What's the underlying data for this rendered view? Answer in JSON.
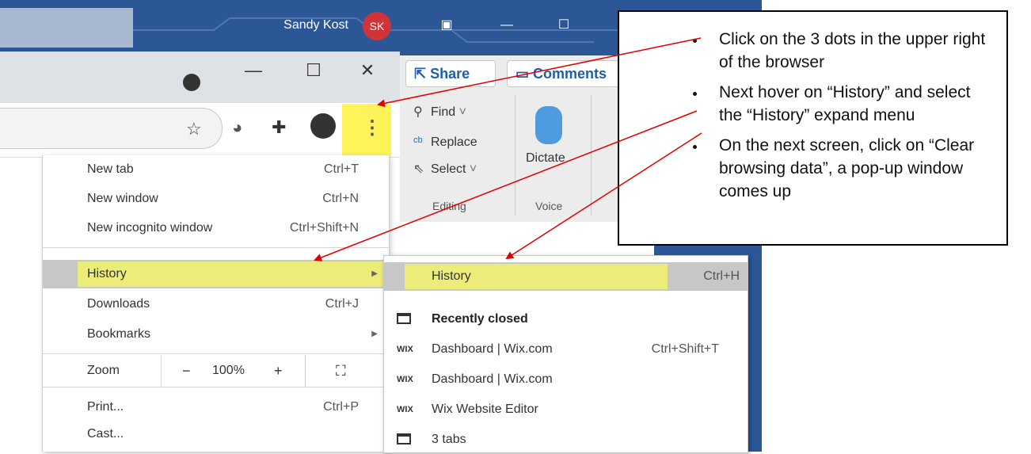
{
  "office": {
    "user_name": "Sandy Kost",
    "user_initials": "SK",
    "share_label": "Share",
    "comments_label": "Comments",
    "find_label": "Find",
    "replace_label": "Replace",
    "select_label": "Select",
    "dictate_label": "Dictate",
    "editing_group": "Editing",
    "voice_group": "Voice"
  },
  "chrome_menu": {
    "new_tab": {
      "label": "New tab",
      "shortcut": "Ctrl+T"
    },
    "new_window": {
      "label": "New window",
      "shortcut": "Ctrl+N"
    },
    "new_incognito": {
      "label": "New incognito window",
      "shortcut": "Ctrl+Shift+N"
    },
    "history": {
      "label": "History"
    },
    "downloads": {
      "label": "Downloads",
      "shortcut": "Ctrl+J"
    },
    "bookmarks": {
      "label": "Bookmarks"
    },
    "zoom": {
      "label": "Zoom",
      "minus": "−",
      "value": "100%",
      "plus": "+"
    },
    "print": {
      "label": "Print...",
      "shortcut": "Ctrl+P"
    },
    "cast": {
      "label": "Cast..."
    }
  },
  "history_submenu": {
    "history": {
      "label": "History",
      "shortcut": "Ctrl+H"
    },
    "recently_closed": "Recently closed",
    "items": [
      {
        "icon": "WIX",
        "label": "Dashboard | Wix.com",
        "shortcut": "Ctrl+Shift+T"
      },
      {
        "icon": "WIX",
        "label": "Dashboard | Wix.com",
        "shortcut": ""
      },
      {
        "icon": "WIX",
        "label": "Wix Website Editor",
        "shortcut": ""
      }
    ],
    "tabs_label": "3 tabs"
  },
  "callout": {
    "steps": [
      "Click on the 3 dots in the upper right of the browser",
      "Next hover on “History” and select the “History” expand menu",
      "On the next screen, click on “Clear browsing data”, a pop-up window comes up"
    ]
  },
  "colors": {
    "highlight_yellow": "#fff35a",
    "office_blue": "#2b5797",
    "arrow_red": "#e00000"
  }
}
